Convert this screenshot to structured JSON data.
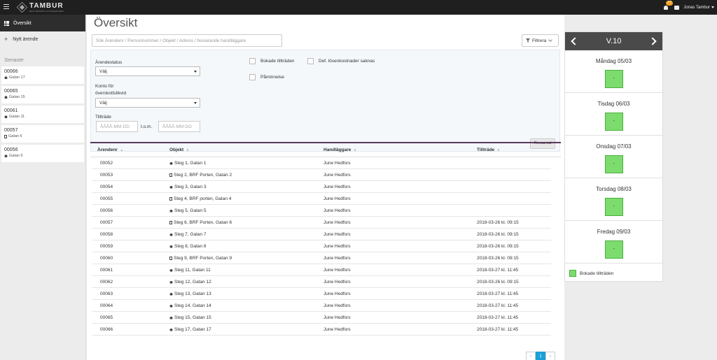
{
  "header": {
    "logo_name": "TAMBUR",
    "logo_sub": "DEN SMARTA NYCKELBUKEN",
    "notification_count": "77",
    "user_name": "Jonas Tambur"
  },
  "sidebar": {
    "nav": [
      {
        "label": "Översikt",
        "icon": "grid-icon"
      },
      {
        "label": "Nytt ärende",
        "icon": "plus-icon"
      }
    ],
    "recent_heading": "Senaste",
    "recent": [
      {
        "num": "00066",
        "addr": "Gatan 17",
        "icon": "house"
      },
      {
        "num": "00065",
        "addr": "Gatan 15",
        "icon": "house"
      },
      {
        "num": "00061",
        "addr": "Gatan 11",
        "icon": "house"
      },
      {
        "num": "00057",
        "addr": "Gatan 6",
        "icon": "building"
      },
      {
        "num": "00056",
        "addr": "Gatan 5",
        "icon": "house"
      }
    ]
  },
  "main": {
    "title": "Översikt",
    "search_placeholder": "Sök  Ärendenr / Personnummer / Objekt / Adress /  Nuvarande handläggare",
    "filter_label": "Filtrera"
  },
  "filters": {
    "status_label": "Ärendestatus",
    "status_value": "Välj",
    "account_label_1": "Konto för",
    "account_label_2": "överskottslikvid",
    "account_value": "Välj",
    "date_label": "Tillträde",
    "date_from_placeholder": "ÅÅÅÅ-MM-DD",
    "date_sep": "t.o.m.",
    "date_to_placeholder": "ÅÅÅÅ-MM-DD",
    "check_booked": "Bokade tillträden",
    "check_missing_costs": "Def. lösenkostnader saknas",
    "check_reminder": "Påminnelse",
    "clear_label": "Rensa val"
  },
  "table": {
    "columns": [
      "Ärendenr",
      "Objekt",
      "Handläggare",
      "Tillträde"
    ],
    "rows": [
      {
        "id": "00052",
        "icon": "house",
        "obj": "Steg 1, Gatan 1",
        "handler": "June Hedfors",
        "access": ""
      },
      {
        "id": "00053",
        "icon": "building",
        "obj": "Steg 2, BRF Porten, Gatan 2",
        "handler": "June Hedfors",
        "access": ""
      },
      {
        "id": "00054",
        "icon": "house",
        "obj": "Steg 3, Gatan 3",
        "handler": "June Hedfors",
        "access": ""
      },
      {
        "id": "00055",
        "icon": "building",
        "obj": "Steg 4, BRF porten, Gatan 4",
        "handler": "June Hedfors",
        "access": ""
      },
      {
        "id": "00056",
        "icon": "house",
        "obj": "Steg 5, Gatan 5",
        "handler": "June Hedfors",
        "access": ""
      },
      {
        "id": "00057",
        "icon": "building",
        "obj": "Steg 6, BRF Porten, Gatan 6",
        "handler": "June Hedfors",
        "access": "2018-03-26 kl. 09:15"
      },
      {
        "id": "00058",
        "icon": "house",
        "obj": "Steg 7, Gatan 7",
        "handler": "June Hedfors",
        "access": "2018-03-26 kl. 09:15"
      },
      {
        "id": "00059",
        "icon": "house",
        "obj": "Steg 8, Gatan 8",
        "handler": "June Hedfors",
        "access": "2018-03-26 kl. 09:15"
      },
      {
        "id": "00060",
        "icon": "building",
        "obj": "Steg 9, BRF Porten, Gatan 9",
        "handler": "June Hedfors",
        "access": "2018-03-26 kl. 09:15"
      },
      {
        "id": "00061",
        "icon": "house",
        "obj": "Steg 11, Gatan 11",
        "handler": "June Hedfors",
        "access": "2018-03-27 kl. 11:45"
      },
      {
        "id": "00062",
        "icon": "house",
        "obj": "Steg 12, Gatan 12",
        "handler": "June Hedfors",
        "access": "2018-03-26 kl. 09:15"
      },
      {
        "id": "00063",
        "icon": "house",
        "obj": "Steg 13, Gatan 13",
        "handler": "June Hedfors",
        "access": "2018-03-27 kl. 11:45"
      },
      {
        "id": "00064",
        "icon": "house",
        "obj": "Steg 14, Gatan 14",
        "handler": "June Hedfors",
        "access": "2018-03-27 kl. 11:45"
      },
      {
        "id": "00065",
        "icon": "house",
        "obj": "Steg 15, Gatan 15",
        "handler": "June Hedfors",
        "access": "2018-03-27 kl. 11:45"
      },
      {
        "id": "00066",
        "icon": "house",
        "obj": "Steg 17, Gatan 17",
        "handler": "June Hedfors",
        "access": "2018-03-27 kl. 11:45"
      }
    ]
  },
  "pagination": {
    "prev": "‹",
    "current": "1",
    "next": "›"
  },
  "calendar": {
    "week": "V.10",
    "days": [
      {
        "name": "Måndag 05/03",
        "slot": "-"
      },
      {
        "name": "Tisdag 06/03",
        "slot": "-"
      },
      {
        "name": "Onsdag 07/03",
        "slot": "-"
      },
      {
        "name": "Torsdag 08/03",
        "slot": "-"
      },
      {
        "name": "Fredag 09/03",
        "slot": "-"
      }
    ],
    "legend": "Bokade tillträden",
    "slot_color": "#7ddc6e"
  }
}
